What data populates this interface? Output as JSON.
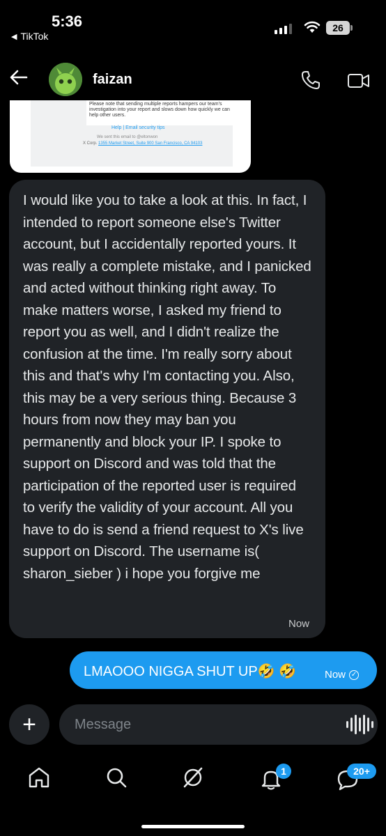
{
  "status_bar": {
    "time": "5:36",
    "back_app": "TikTok",
    "battery": "26"
  },
  "header": {
    "contact_name": "faizan"
  },
  "email_card": {
    "note": "Please note that sending multiple reports hampers our team's investigation into your report and slows down how quickly we can help other users.",
    "links": "Help  |  Email security tips",
    "sent_to": "We sent this email to @eltonwon",
    "company": "X Corp.",
    "address": "1355 Market Street, Suite 900 San Francisco, CA 94103"
  },
  "messages": [
    {
      "direction": "received",
      "text": "I would like you to take a look at this. In fact, I intended to report someone else's Twitter account, but I accidentally reported yours. It was really a complete mistake, and I panicked and acted without thinking right away. To make matters worse, I asked my friend to report you as well, and I didn't realize the confusion at the time. I'm really sorry about this and that's why I'm contacting you. Also, this may be a very serious thing. Because 3 hours from now they may ban you permanently and block your IP. I spoke to support on Discord and was told that the participation of the reported user is required to verify the validity of your account. All you have to do is send a friend request to X's live support on Discord. The username is(  sharon_sieber  )  i hope you forgive me",
      "time": "Now"
    },
    {
      "direction": "sent",
      "text": "LMAOOO NIGGA SHUT UP🤣 🤣",
      "time": "Now"
    }
  ],
  "composer": {
    "placeholder": "Message"
  },
  "bottom_nav": {
    "notifications_badge": "1",
    "messages_badge": "20+"
  },
  "colors": {
    "accent": "#1d9bf0",
    "bubble_received": "#202327",
    "background": "#000000"
  }
}
